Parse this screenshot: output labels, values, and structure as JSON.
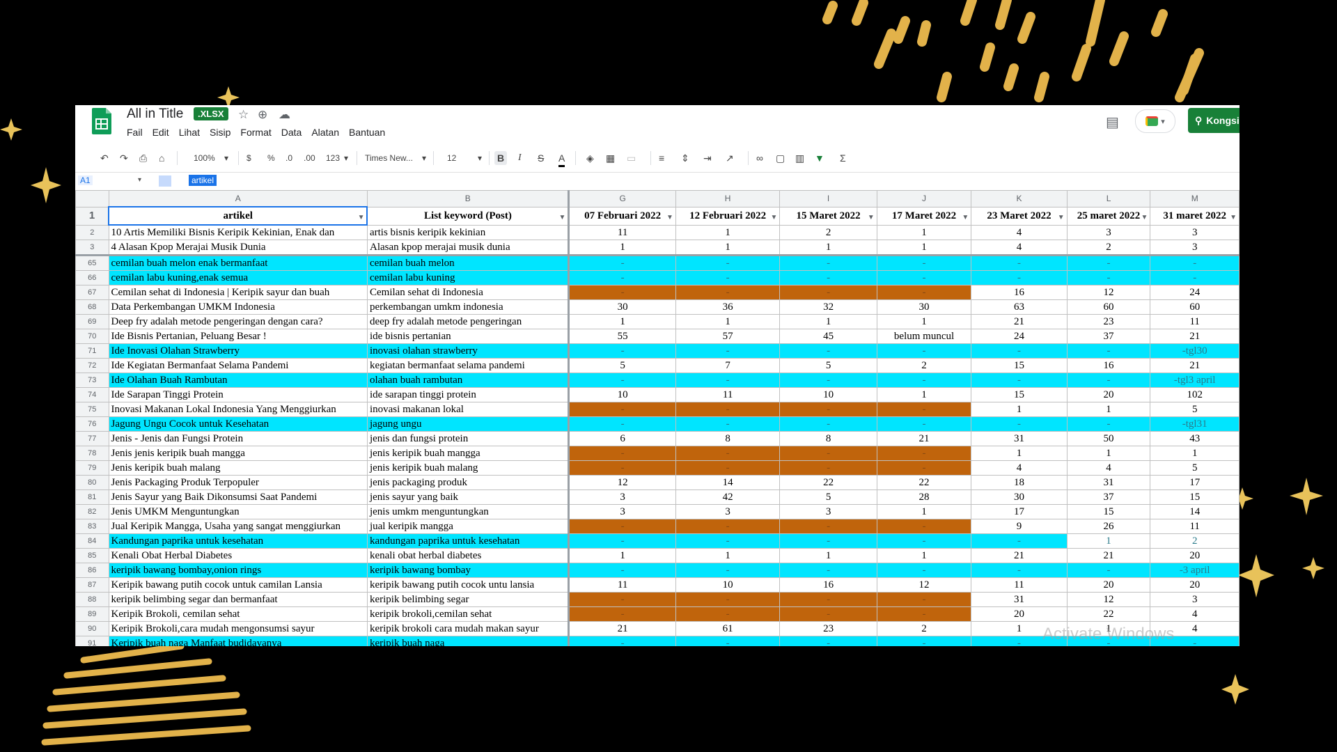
{
  "title_bar": {
    "doc_title": "All in Title",
    "file_badge": ".XLSX",
    "share_label": "Kongsi"
  },
  "menu": [
    "Fail",
    "Edit",
    "Lihat",
    "Sisip",
    "Format",
    "Data",
    "Alatan",
    "Bantuan"
  ],
  "toolbar": {
    "zoom": "100%",
    "currency": "$",
    "percent": "%",
    "dec_decrease": ".0",
    "dec_increase": ".00",
    "number_format": "123",
    "font": "Times New...",
    "font_size": "12",
    "bold": "B",
    "italic": "I",
    "strike": "S",
    "text_color": "A"
  },
  "formula_bar": {
    "cell_ref": "A1",
    "value": "artikel"
  },
  "columns": [
    "A",
    "B",
    "G",
    "H",
    "I",
    "J",
    "K",
    "L",
    "M"
  ],
  "header_row": [
    "artikel",
    "List keyword (Post)",
    "07 Februari 2022",
    "12 Februari 2022",
    "15 Maret 2022",
    "17 Maret 2022",
    "23 Maret 2022",
    "25 maret 2022",
    "31 maret 2022"
  ],
  "rows": [
    {
      "n": "2",
      "a": "10 Artis Memiliki Bisnis Keripik Kekinian, Enak dan",
      "b": "artis bisnis keripik kekinian",
      "v": [
        "11",
        "1",
        "2",
        "1",
        "4",
        "3",
        "3"
      ],
      "style": "w"
    },
    {
      "n": "3",
      "a": "4 Alasan Kpop Merajai Musik Dunia",
      "b": "Alasan kpop merajai musik dunia",
      "v": [
        "1",
        "1",
        "1",
        "1",
        "4",
        "2",
        "3"
      ],
      "style": "w"
    },
    {
      "n": "65",
      "a": "cemilan buah melon enak bermanfaat",
      "b": "cemilan buah melon",
      "v": [
        "-",
        "-",
        "-",
        "-",
        "-",
        "-",
        "-"
      ],
      "style": "c"
    },
    {
      "n": "66",
      "a": "cemilan labu kuning,enak semua",
      "b": "cemilan labu kuning",
      "v": [
        "-",
        "-",
        "-",
        "-",
        "-",
        "-",
        "-"
      ],
      "style": "c"
    },
    {
      "n": "67",
      "a": "Cemilan sehat di Indonesia | Keripik sayur dan buah",
      "b": "Cemilan sehat di Indonesia",
      "v": [
        "-",
        "-",
        "-",
        "-",
        "16",
        "12",
        "24"
      ],
      "style": "b"
    },
    {
      "n": "68",
      "a": "Data Perkembangan UMKM Indonesia",
      "b": "perkembangan umkm indonesia",
      "v": [
        "30",
        "36",
        "32",
        "30",
        "63",
        "60",
        "60"
      ],
      "style": "w"
    },
    {
      "n": "69",
      "a": "Deep fry adalah metode pengeringan dengan cara?",
      "b": "deep fry adalah metode pengeringan",
      "v": [
        "1",
        "1",
        "1",
        "1",
        "21",
        "23",
        "11"
      ],
      "style": "w"
    },
    {
      "n": "70",
      "a": "Ide Bisnis Pertanian, Peluang Besar !",
      "b": "ide bisnis pertanian",
      "v": [
        "55",
        "57",
        "45",
        "belum muncul",
        "24",
        "37",
        "21"
      ],
      "style": "w"
    },
    {
      "n": "71",
      "a": "Ide Inovasi Olahan Strawberry",
      "b": "inovasi olahan strawberry",
      "v": [
        "-",
        "-",
        "-",
        "-",
        "-",
        "-",
        "-tgl30"
      ],
      "style": "c"
    },
    {
      "n": "72",
      "a": "Ide Kegiatan Bermanfaat Selama Pandemi",
      "b": "kegiatan bermanfaat selama pandemi",
      "v": [
        "5",
        "7",
        "5",
        "2",
        "15",
        "16",
        "21"
      ],
      "style": "w"
    },
    {
      "n": "73",
      "a": "Ide Olahan Buah Rambutan",
      "b": "olahan buah rambutan",
      "v": [
        "-",
        "-",
        "-",
        "-",
        "-",
        "-",
        "-tgl3 april"
      ],
      "style": "c"
    },
    {
      "n": "74",
      "a": "Ide Sarapan Tinggi Protein",
      "b": "ide sarapan tinggi protein",
      "v": [
        "10",
        "11",
        "10",
        "1",
        "15",
        "20",
        "102"
      ],
      "style": "w"
    },
    {
      "n": "75",
      "a": "Inovasi Makanan Lokal Indonesia Yang Menggiurkan",
      "b": "inovasi makanan lokal",
      "v": [
        "-",
        "-",
        "-",
        "-",
        "1",
        "1",
        "5"
      ],
      "style": "b"
    },
    {
      "n": "76",
      "a": "Jagung Ungu Cocok untuk Kesehatan",
      "b": "jagung ungu",
      "v": [
        "-",
        "-",
        "-",
        "-",
        "-",
        "-",
        "-tgl31"
      ],
      "style": "c"
    },
    {
      "n": "77",
      "a": "Jenis - Jenis dan Fungsi Protein",
      "b": "jenis dan fungsi protein",
      "v": [
        "6",
        "8",
        "8",
        "21",
        "31",
        "50",
        "43"
      ],
      "style": "w"
    },
    {
      "n": "78",
      "a": "Jenis jenis keripik buah mangga",
      "b": "jenis keripik buah mangga",
      "v": [
        "-",
        "-",
        "-",
        "-",
        "1",
        "1",
        "1"
      ],
      "style": "b"
    },
    {
      "n": "79",
      "a": "Jenis keripik buah malang",
      "b": "jenis keripik buah malang",
      "v": [
        "-",
        "-",
        "-",
        "-",
        "4",
        "4",
        "5"
      ],
      "style": "b"
    },
    {
      "n": "80",
      "a": "Jenis Packaging Produk Terpopuler",
      "b": "jenis packaging produk",
      "v": [
        "12",
        "14",
        "22",
        "22",
        "18",
        "31",
        "17"
      ],
      "style": "w"
    },
    {
      "n": "81",
      "a": "Jenis Sayur yang Baik Dikonsumsi Saat Pandemi",
      "b": "jenis sayur yang baik",
      "v": [
        "3",
        "42",
        "5",
        "28",
        "30",
        "37",
        "15"
      ],
      "style": "w"
    },
    {
      "n": "82",
      "a": "Jenis UMKM Menguntungkan",
      "b": "jenis umkm menguntungkan",
      "v": [
        "3",
        "3",
        "3",
        "1",
        "17",
        "15",
        "14"
      ],
      "style": "w"
    },
    {
      "n": "83",
      "a": "Jual Keripik Mangga, Usaha yang sangat menggiurkan",
      "b": "jual keripik mangga",
      "v": [
        "-",
        "-",
        "-",
        "-",
        "9",
        "26",
        "11"
      ],
      "style": "b"
    },
    {
      "n": "84",
      "a": "Kandungan paprika untuk kesehatan",
      "b": "kandungan paprika untuk kesehatan",
      "v": [
        "-",
        "-",
        "-",
        "-",
        "-",
        "1",
        "2"
      ],
      "style": "c2"
    },
    {
      "n": "85",
      "a": "Kenali Obat Herbal Diabetes",
      "b": "kenali obat herbal diabetes",
      "v": [
        "1",
        "1",
        "1",
        "1",
        "21",
        "21",
        "20"
      ],
      "style": "w"
    },
    {
      "n": "86",
      "a": "keripik bawang bombay,onion rings",
      "b": "keripik bawang bombay",
      "v": [
        "-",
        "-",
        "-",
        "-",
        "-",
        "-",
        "-3 april"
      ],
      "style": "c"
    },
    {
      "n": "87",
      "a": "Keripik bawang putih cocok untuk camilan Lansia",
      "b": "keripik bawang putih cocok untu lansia",
      "v": [
        "11",
        "10",
        "16",
        "12",
        "11",
        "20",
        "20"
      ],
      "style": "w"
    },
    {
      "n": "88",
      "a": "keripik belimbing segar dan bermanfaat",
      "b": "keripik belimbing segar",
      "v": [
        "-",
        "-",
        "-",
        "-",
        "31",
        "12",
        "3"
      ],
      "style": "b"
    },
    {
      "n": "89",
      "a": "Keripik Brokoli, cemilan sehat",
      "b": "keripik brokoli,cemilan sehat",
      "v": [
        "-",
        "-",
        "-",
        "-",
        "20",
        "22",
        "4"
      ],
      "style": "b"
    },
    {
      "n": "90",
      "a": "Keripik Brokoli,cara mudah mengonsumsi sayur",
      "b": "keripik brokoli cara mudah makan sayur",
      "v": [
        "21",
        "61",
        "23",
        "2",
        "1",
        "1",
        "4"
      ],
      "style": "w"
    },
    {
      "n": "91",
      "a": "Keripik buah naga Manfaat budidayanya",
      "b": "keripik buah naga",
      "v": [
        "-",
        "-",
        "-",
        "-",
        "-",
        "-",
        "-"
      ],
      "style": "c"
    }
  ],
  "watermark": "Activate Windows",
  "colors": {
    "cyan_highlight": "#00e5ff",
    "brown_fill": "#c0640c",
    "sheets_green": "#188038",
    "gold_decoration": "#e8b84a"
  }
}
